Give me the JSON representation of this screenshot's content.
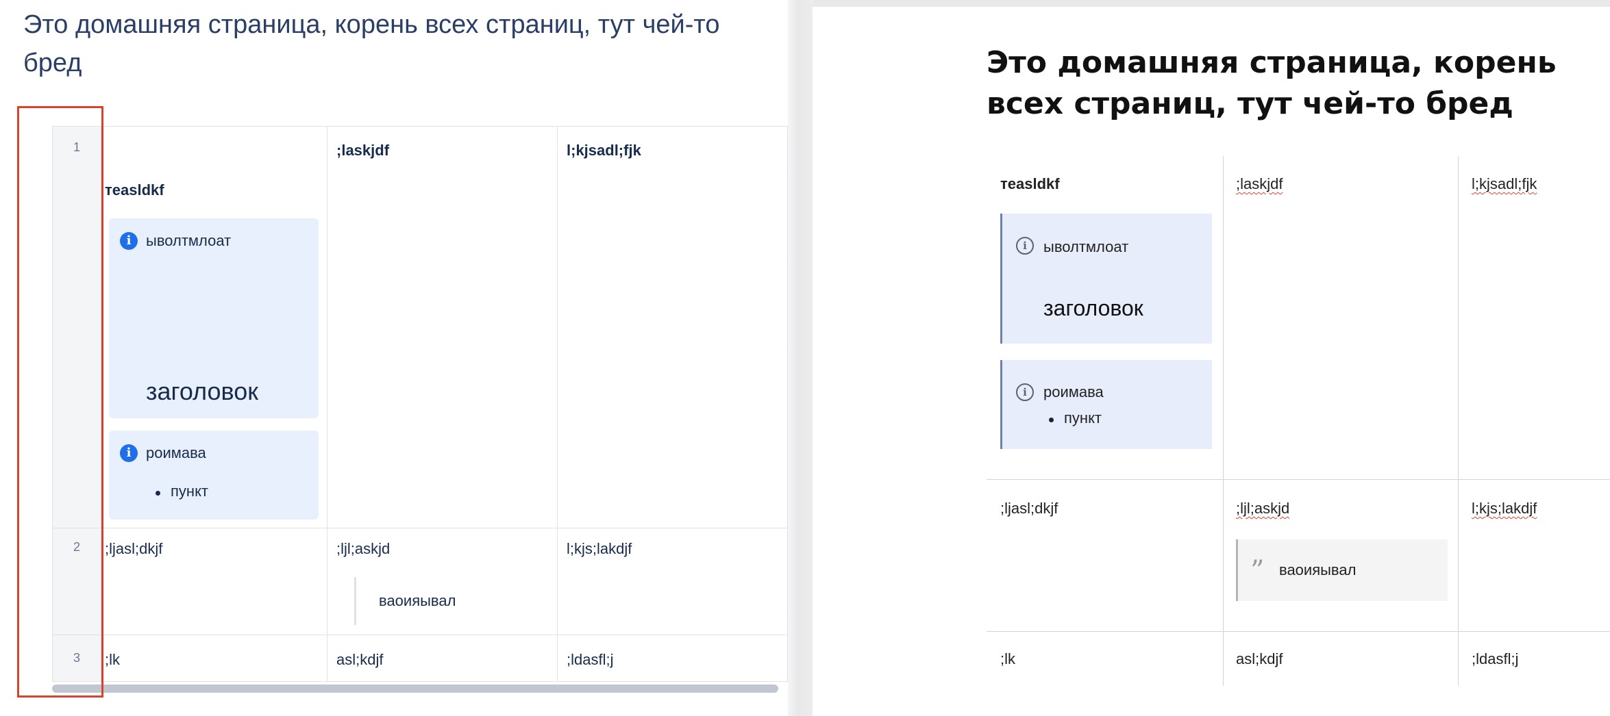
{
  "left": {
    "title": "Это домашняя страница, корень всех страниц, тут чей-то бред",
    "row_numbers": [
      "1",
      "2",
      "3"
    ],
    "header": {
      "col1": "теasldkf",
      "col2": ";laskjdf",
      "col3": "l;kjsadl;fjk"
    },
    "panel1": {
      "icon": "info-icon",
      "text": "ыволтмлоат",
      "heading": "заголовок"
    },
    "panel2": {
      "icon": "info-icon",
      "text": "роимава",
      "bullet": "пункт"
    },
    "row2": {
      "col1": ";ljasl;dkjf",
      "col2": ";ljl;askjd",
      "quote": "ваоияывал",
      "col3": "l;kjs;lakdjf"
    },
    "row3": {
      "col1": ";lk",
      "col2": "asl;kdjf",
      "col3": ";ldasfl;j"
    },
    "selection_color": "#d9432c"
  },
  "right": {
    "title": "Это домашняя страница, корень всех страниц, тут чей-то бред",
    "header": {
      "col1": "теasldkf",
      "col2": ";laskjdf",
      "col3": "l;kjsadl;fjk"
    },
    "panel1": {
      "icon": "info-icon",
      "text": "ыволтмлоат",
      "heading": "заголовок"
    },
    "panel2": {
      "icon": "info-icon",
      "text": "роимава",
      "bullet": "пункт"
    },
    "row2": {
      "col1": ";ljasl;dkjf",
      "col2": ";ljl;askjd",
      "quote_icon": "quote-icon",
      "quote": "ваоияывал",
      "col3": "l;kjs;lakdjf"
    },
    "row3": {
      "col1": ";lk",
      "col2": "asl;kdjf",
      "col3": ";ldasfl;j"
    }
  }
}
